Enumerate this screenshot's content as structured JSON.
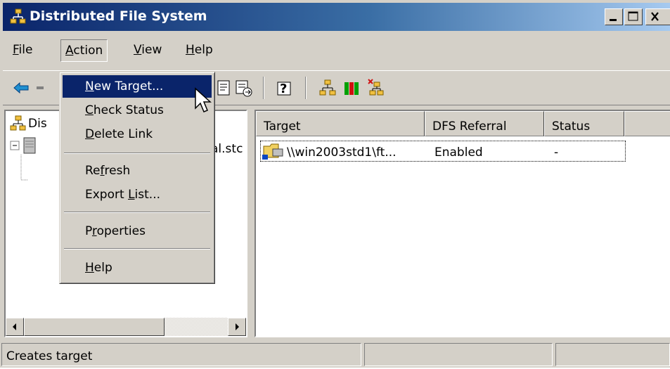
{
  "window": {
    "title": "Distributed File System"
  },
  "menubar": {
    "items": [
      {
        "label": "File",
        "u": "F",
        "rest": "ile"
      },
      {
        "label": "Action",
        "u": "A",
        "rest": "ction"
      },
      {
        "label": "View",
        "u": "V",
        "rest": "iew"
      },
      {
        "label": "Help",
        "u": "H",
        "rest": "elp"
      }
    ]
  },
  "action_menu": {
    "items": [
      {
        "label": "New Target...",
        "pre": "",
        "u": "N",
        "post": "ew Target..."
      },
      {
        "label": "Check Status",
        "pre": "",
        "u": "C",
        "post": "heck Status"
      },
      {
        "label": "Delete Link",
        "pre": "",
        "u": "D",
        "post": "elete Link"
      },
      {
        "label": "Refresh",
        "pre": "Re",
        "u": "f",
        "post": "resh"
      },
      {
        "label": "Export List...",
        "pre": "Export ",
        "u": "L",
        "post": "ist..."
      },
      {
        "label": "Properties",
        "pre": "P",
        "u": "r",
        "post": "operties"
      },
      {
        "label": "Help",
        "pre": "",
        "u": "H",
        "post": "elp"
      }
    ]
  },
  "tree": {
    "root_label_partial": "Dis",
    "node_label_partial": "al.stc"
  },
  "list": {
    "columns": [
      "Target",
      "DFS Referral",
      "Status"
    ],
    "rows": [
      {
        "target": "\\\\win2003std1\\ft...",
        "referral": "Enabled",
        "status": "-"
      }
    ]
  },
  "statusbar": {
    "text": "Creates target"
  },
  "colors": {
    "title_start": "#0a246a",
    "title_end": "#a6caf0",
    "highlight": "#0a246a",
    "face": "#d4d0c8"
  },
  "icons": [
    "dfs-icon",
    "back-icon",
    "forward-icon",
    "properties-icon",
    "export-icon",
    "help-icon",
    "new-root-icon",
    "check-status-icon",
    "new-link-icon",
    "folder-icon",
    "server-icon"
  ]
}
